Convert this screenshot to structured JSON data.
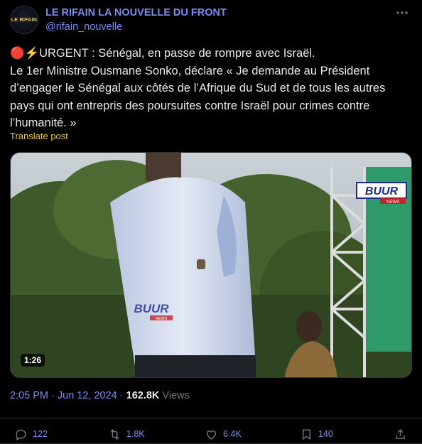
{
  "author": {
    "name": "LE RIFAIN LA NOUVELLE DU FRONT",
    "handle": "@rifain_nouvelle",
    "avatar_text": "LE RIFAIN"
  },
  "tweet": {
    "line1": "🔴⚡URGENT : Sénégal, en passe de rompre avec Israël.",
    "line2": "Le 1er Ministre Ousmane Sonko, déclare « Je demande au Président d’engager le Sénégal aux côtés de l’Afrique du Sud et de tous les autres pays qui ont entrepris des poursuites contre Israël pour crimes contre l’humanité. »",
    "translate_label": "Translate post"
  },
  "media": {
    "duration": "1:26",
    "watermark": "BUUR",
    "watermark_sub": "NEWS"
  },
  "meta": {
    "time": "2:05 PM · Jun 12, 2024",
    "separator": " · ",
    "views_count": "162.8K",
    "views_label": " Views"
  },
  "actions": {
    "replies": "122",
    "reposts": "1.8K",
    "likes": "6.4K",
    "bookmarks": "140"
  },
  "colors": {
    "accent": "#7b8cf0",
    "translate": "#f0c64a",
    "background": "#000000"
  },
  "icons": [
    "more-icon",
    "reply-icon",
    "repost-icon",
    "like-icon",
    "bookmark-icon",
    "share-icon"
  ]
}
